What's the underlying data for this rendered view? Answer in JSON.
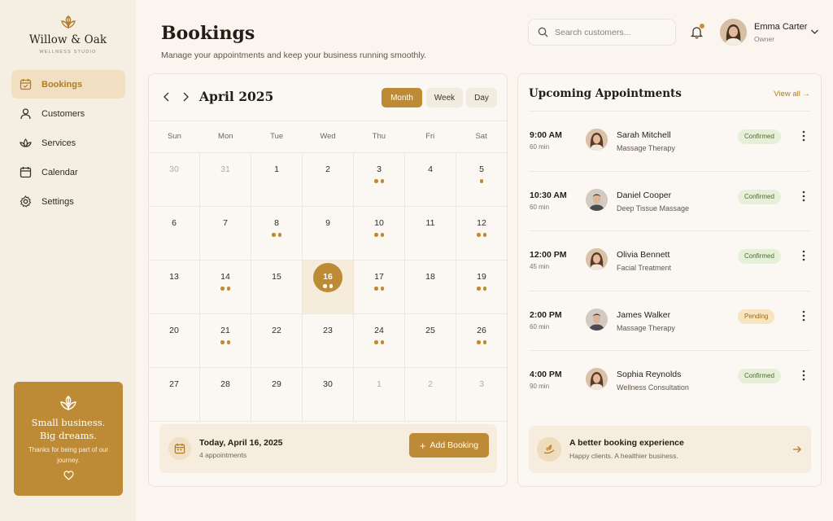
{
  "colors": {
    "accent": "#bd8a35",
    "sidebar_bg": "#f5eee3",
    "page_bg": "#faf6ef",
    "confirmed_bg": "#e6efd8",
    "pending_bg": "#f8e5c0"
  },
  "brand": {
    "name": "Willow & Oak",
    "tagline": "WELLNESS STUDIO",
    "icon": "leaf-icon"
  },
  "sidebar": {
    "items": [
      {
        "label": "Bookings",
        "icon": "calendar-check-icon",
        "active": true
      },
      {
        "label": "Customers",
        "icon": "user-icon",
        "active": false
      },
      {
        "label": "Services",
        "icon": "lotus-icon",
        "active": false
      },
      {
        "label": "Calendar",
        "icon": "calendar-icon",
        "active": false
      },
      {
        "label": "Settings",
        "icon": "gear-icon",
        "active": false
      }
    ],
    "promo": {
      "title_line1": "Small business.",
      "title_line2": "Big dreams.",
      "text": "Thanks for being part of our journey.",
      "icon": "leaf-icon",
      "heart_icon": "heart-icon"
    }
  },
  "header": {
    "title": "Bookings",
    "subtitle": "Manage your appointments and keep your business running smoothly.",
    "search_placeholder": "Search customers...",
    "user": {
      "name": "Emma Carter",
      "role": "Owner"
    }
  },
  "calendar": {
    "month_label": "April 2025",
    "views": [
      "Month",
      "Week",
      "Day"
    ],
    "active_view": "Month",
    "weekdays": [
      "Sun",
      "Mon",
      "Tue",
      "Wed",
      "Thu",
      "Fri",
      "Sat"
    ],
    "weeks": [
      [
        {
          "n": "30",
          "muted": true,
          "dots": 0
        },
        {
          "n": "31",
          "muted": true,
          "dots": 0
        },
        {
          "n": "1",
          "dots": 0
        },
        {
          "n": "2",
          "dots": 0
        },
        {
          "n": "3",
          "dots": 2
        },
        {
          "n": "4",
          "dots": 0
        },
        {
          "n": "5",
          "dots": 1
        }
      ],
      [
        {
          "n": "6",
          "dots": 0
        },
        {
          "n": "7",
          "dots": 0
        },
        {
          "n": "8",
          "dots": 2
        },
        {
          "n": "9",
          "dots": 0
        },
        {
          "n": "10",
          "dots": 2
        },
        {
          "n": "11",
          "dots": 0
        },
        {
          "n": "12",
          "dots": 2
        }
      ],
      [
        {
          "n": "13",
          "dots": 0
        },
        {
          "n": "14",
          "dots": 2
        },
        {
          "n": "15",
          "dots": 0
        },
        {
          "n": "16",
          "dots": 2,
          "today": true
        },
        {
          "n": "17",
          "dots": 2
        },
        {
          "n": "18",
          "dots": 0
        },
        {
          "n": "19",
          "dots": 2
        }
      ],
      [
        {
          "n": "20",
          "dots": 0
        },
        {
          "n": "21",
          "dots": 2
        },
        {
          "n": "22",
          "dots": 0
        },
        {
          "n": "23",
          "dots": 0
        },
        {
          "n": "24",
          "dots": 2
        },
        {
          "n": "25",
          "dots": 0
        },
        {
          "n": "26",
          "dots": 2
        }
      ],
      [
        {
          "n": "27",
          "dots": 0
        },
        {
          "n": "28",
          "dots": 0
        },
        {
          "n": "29",
          "dots": 0
        },
        {
          "n": "30",
          "dots": 0
        },
        {
          "n": "1",
          "muted": true,
          "dots": 0
        },
        {
          "n": "2",
          "muted": true,
          "dots": 0
        },
        {
          "n": "3",
          "muted": true,
          "dots": 0
        }
      ]
    ],
    "today": {
      "label": "Today, April 16, 2025",
      "count": "4 appointments"
    },
    "add_button": "Add Booking"
  },
  "appointments": {
    "title": "Upcoming Appointments",
    "view_all": "View all →",
    "items": [
      {
        "time": "9:00 AM",
        "duration": "60 min",
        "name": "Sarah Mitchell",
        "service": "Massage Therapy",
        "status": "Confirmed",
        "avatar": "female"
      },
      {
        "time": "10:30 AM",
        "duration": "60 min",
        "name": "Daniel Cooper",
        "service": "Deep Tissue Massage",
        "status": "Confirmed",
        "avatar": "male"
      },
      {
        "time": "12:00 PM",
        "duration": "45 min",
        "name": "Olivia Bennett",
        "service": "Facial Treatment",
        "status": "Confirmed",
        "avatar": "female"
      },
      {
        "time": "2:00 PM",
        "duration": "60 min",
        "name": "James Walker",
        "service": "Massage Therapy",
        "status": "Pending",
        "avatar": "male"
      },
      {
        "time": "4:00 PM",
        "duration": "90 min",
        "name": "Sophia Reynolds",
        "service": "Wellness Consultation",
        "status": "Confirmed",
        "avatar": "female"
      }
    ],
    "tip": {
      "title": "A better booking experience",
      "text": "Happy clients. A healthier business."
    }
  }
}
